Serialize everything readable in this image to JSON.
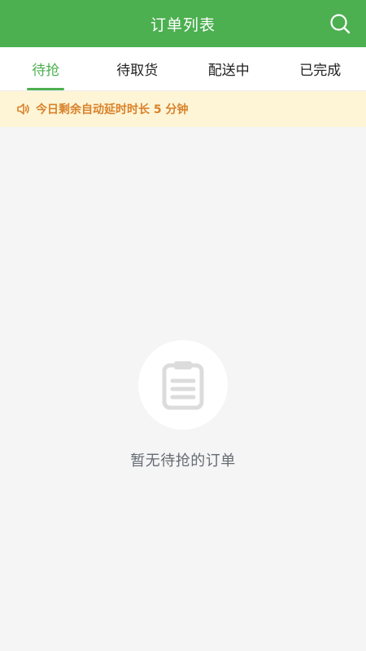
{
  "header": {
    "title": "订单列表",
    "search_icon": "search-icon"
  },
  "tabs": [
    {
      "label": "待抢",
      "active": true
    },
    {
      "label": "待取货",
      "active": false
    },
    {
      "label": "配送中",
      "active": false
    },
    {
      "label": "已完成",
      "active": false
    }
  ],
  "notice": {
    "icon": "speaker-icon",
    "text": "今日剩余自动延时时长 5 分钟"
  },
  "empty_state": {
    "icon": "clipboard-icon",
    "text": "暂无待抢的订单"
  },
  "colors": {
    "primary": "#4caf50",
    "notice_bg": "#fdf5d6",
    "notice_text": "#d9822b",
    "page_bg": "#f5f5f5"
  }
}
